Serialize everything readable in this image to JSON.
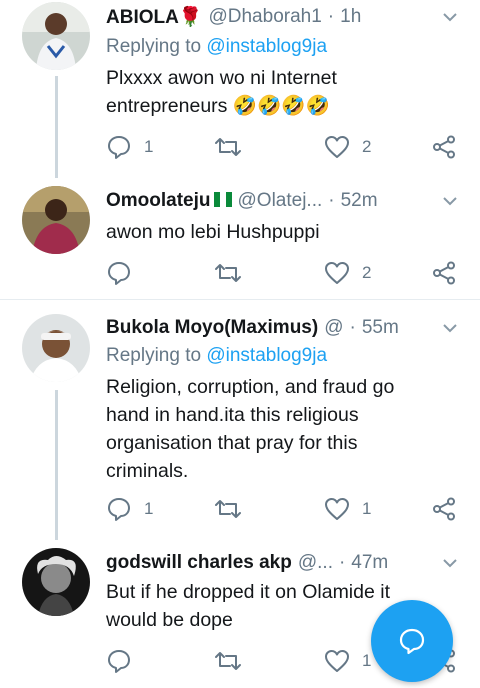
{
  "colors": {
    "accent": "#1da1f2",
    "muted": "#657786",
    "divider": "#e6ecf0"
  },
  "tweets": [
    {
      "name": "ABIOLA🌹",
      "handle": "@Dhaborah1",
      "dot": "·",
      "time": "1h",
      "reply_prefix": "Replying to ",
      "reply_handle": "@instablog9ja",
      "text": "Plxxxx awon wo ni Internet entrepreneurs 🤣🤣🤣🤣",
      "replies": "1",
      "retweets": "",
      "likes": "2"
    },
    {
      "name": "Omoolateju",
      "name_flag": "nigeria-flag",
      "handle": "@Olatej...",
      "dot": "·",
      "time": "52m",
      "text": "awon mo lebi Hushpuppi",
      "replies": "",
      "retweets": "",
      "likes": "2"
    },
    {
      "name": "Bukola Moyo(Maximus)",
      "handle": "@",
      "dot": "·",
      "time": "55m",
      "reply_prefix": "Replying to ",
      "reply_handle": "@instablog9ja",
      "text": "Religion, corruption, and fraud go hand in hand.ita this religious organisation that pray for this criminals.",
      "replies": "1",
      "retweets": "",
      "likes": "1"
    },
    {
      "name": "godswill charles akp",
      "handle": "@...",
      "dot": "·",
      "time": "47m",
      "text": "But if he dropped it on Olamide it would be dope",
      "replies": "",
      "retweets": "",
      "likes": "1"
    }
  ],
  "fab": {
    "icon": "compose-reply-icon"
  }
}
